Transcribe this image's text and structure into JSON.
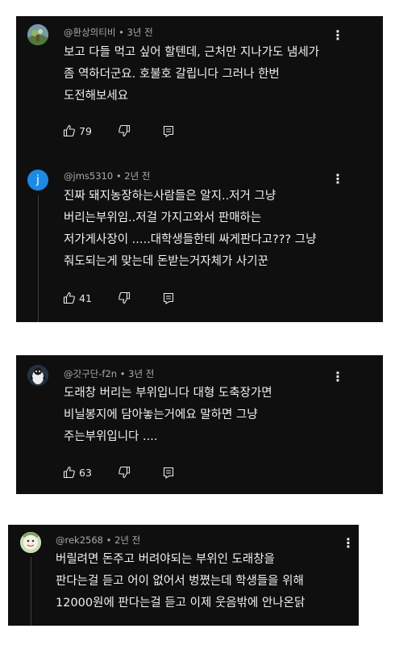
{
  "comments": [
    {
      "author": "@환상의티비",
      "time": "3년 전",
      "lines": [
        "보고 다들 먹고 싶어 할텐데,  근처만 지나가도 냄세가",
        "좀 역하더군요. 호불호 갈립니다 그러나 한번",
        "도전해보세요"
      ],
      "likes": "79",
      "avatar_icon": "nature-avatar-icon"
    },
    {
      "author": "@jms5310",
      "time": "2년 전",
      "avatar_letter": "j",
      "lines": [
        "진짜 돼지농장하는사람들은 알지..저거 그냥",
        "버리는부위임..저걸 가지고와서 판매하는",
        "저가게사장이 .....대학생들한테 싸게판다고???  그냥",
        "줘도되는게 맞는데 돈받는거자체가 사기꾼"
      ],
      "likes": "41"
    },
    {
      "author": "@갓구단-f2n",
      "time": "3년 전",
      "lines": [
        "도래창 버리는 부위입니다 대형 도축장가면",
        "비닐봉지에 담아놓는거에요 말하면 그냥",
        "주는부위입니다 ...."
      ],
      "likes": "63",
      "avatar_icon": "penguin-avatar-icon"
    },
    {
      "author": "@rek2568",
      "time": "2년 전",
      "lines": [
        "버릴려면 돈주고 버려야되는 부위인 도래창을",
        "판다는걸 듣고 어이 없어서 벙쪘는데 학생들을 위해",
        "12000원에 판다는걸 듣고 이제 웃음밖에 안나온닭"
      ],
      "avatar_icon": "cartoon-avatar-icon"
    }
  ],
  "ui": {
    "separator": "•",
    "more_icon": "kebab-menu-icon"
  }
}
